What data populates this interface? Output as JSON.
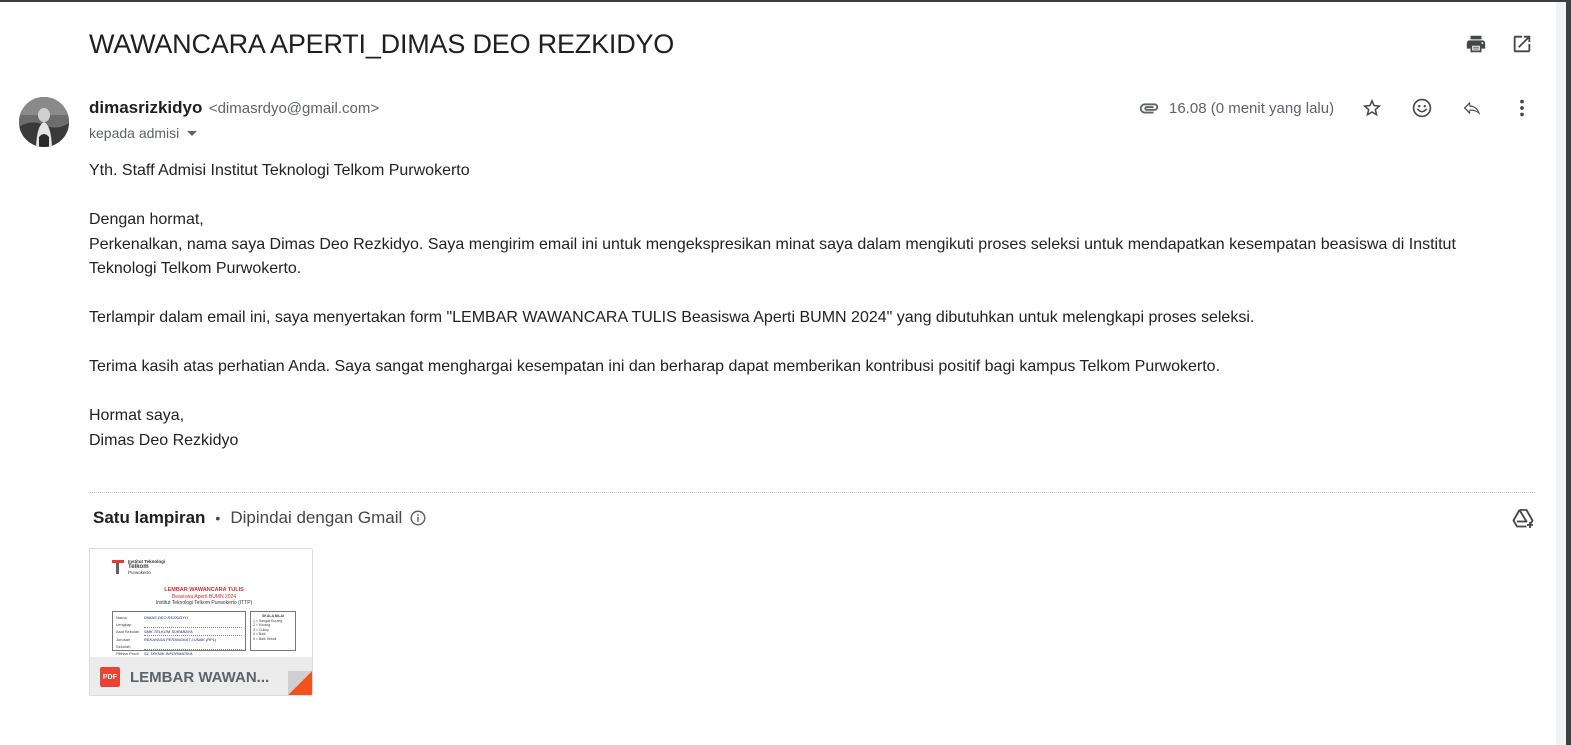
{
  "message": {
    "subject": "WAWANCARA APERTI_DIMAS DEO REZKIDYO",
    "sender_name": "dimasrizkidyo",
    "sender_email": "<dimasrdyo@gmail.com>",
    "to_label": "kepada admisi",
    "timestamp": "16.08 (0 menit yang lalu)",
    "body": {
      "greeting": "Yth. Staff Admisi Institut Teknologi Telkom Purwokerto",
      "salutation": "Dengan hormat,",
      "para1": "Perkenalkan, nama saya Dimas Deo Rezkidyo. Saya mengirim email ini untuk mengekspresikan minat saya dalam mengikuti proses seleksi untuk mendapatkan kesempatan beasiswa di Institut Teknologi Telkom Purwokerto.",
      "para2": "Terlampir dalam email ini, saya menyertakan form \"LEMBAR WAWANCARA TULIS Beasiswa Aperti BUMN 2024\" yang dibutuhkan untuk melengkapi proses seleksi.",
      "para3": "Terima kasih atas perhatian Anda. Saya sangat menghargai kesempatan ini dan berharap dapat memberikan kontribusi positif bagi kampus Telkom Purwokerto.",
      "closing": "Hormat saya,",
      "signature": "Dimas Deo Rezkidyo"
    }
  },
  "attachments": {
    "count_label": "Satu lampiran",
    "separator": "•",
    "scan_label": "Dipindai dengan Gmail",
    "file": {
      "name": "LEMBAR WAWAN...",
      "type_badge": "PDF",
      "preview": {
        "institution_line1": "Institut Teknologi",
        "institution_line2": "Telkom",
        "institution_line3": "Purwokerto",
        "title": "LEMBAR WAWANCARA TULIS",
        "subtitle": "Beasiswa Aperti BUMN 2024",
        "subtitle2": "Institut Teknologi Telkom Purwokerto (ITTP)",
        "rows": [
          {
            "k": "Nama Lengkap",
            "v": "DIMAS DEO REZKIDYO"
          },
          {
            "k": "Asal Sekolah",
            "v": "SMK TELKOM SURABAYA"
          },
          {
            "k": "Jurusan Sekolah",
            "v": "REKAYASA PERANGKAT LUNAK (RPL)"
          },
          {
            "k": "Pilihan Prodi",
            "v": "S1 TEKNIK INFORMATIKA"
          },
          {
            "k": "Nomor HP/WA",
            "v": "0821 XXXX XXXX"
          }
        ],
        "right_title": "SKALA NILAI",
        "right_items": [
          "1 = Sangat Kurang",
          "2 = Kurang",
          "3 = Cukup",
          "4 = Baik",
          "5 = Baik Sekali"
        ]
      }
    }
  },
  "icons": {
    "print": "print-icon",
    "open_new_window": "open-in-new-window-icon",
    "attachment": "paperclip-icon",
    "star": "star-icon",
    "emoji": "emoji-icon",
    "reply": "reply-icon",
    "more": "more-vert-icon",
    "info": "info-icon",
    "add_to_drive": "add-to-drive-icon"
  },
  "colors": {
    "text_primary": "#1f1f1f",
    "text_secondary": "#5f6368",
    "pdf_red": "#ea4335",
    "attachment_footer": "#ececec"
  }
}
